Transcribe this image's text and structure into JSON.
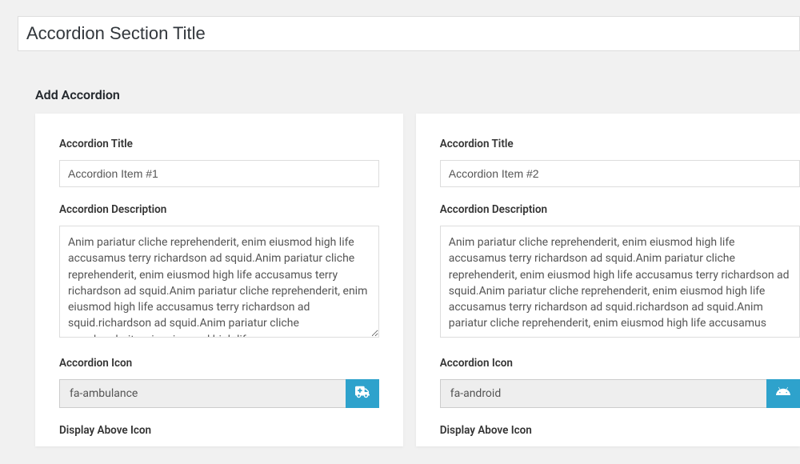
{
  "title_input": {
    "value": "Accordion Section Title"
  },
  "section_header": "Add Accordion",
  "labels": {
    "accordion_title": "Accordion Title",
    "accordion_description": "Accordion Description",
    "accordion_icon": "Accordion Icon",
    "display_above_icon": "Display Above Icon"
  },
  "items": [
    {
      "title": "Accordion Item #1",
      "description": "Anim pariatur cliche reprehenderit, enim eiusmod high life accusamus terry richardson ad squid.Anim pariatur cliche reprehenderit, enim eiusmod high life accusamus terry richardson ad squid.Anim pariatur cliche reprehenderit, enim eiusmod high life accusamus terry richardson ad squid.richardson ad squid.Anim pariatur cliche reprehenderit, enim eiusmod high life accusamus",
      "icon": "fa-ambulance"
    },
    {
      "title": "Accordion Item #2",
      "description": "Anim pariatur cliche reprehenderit, enim eiusmod high life accusamus terry richardson ad squid.Anim pariatur cliche reprehenderit, enim eiusmod high life accusamus terry richardson ad squid.Anim pariatur cliche reprehenderit, enim eiusmod high life accusamus terry richardson ad squid.richardson ad squid.Anim pariatur cliche reprehenderit, enim eiusmod high life accusamus",
      "icon": "fa-android"
    }
  ]
}
